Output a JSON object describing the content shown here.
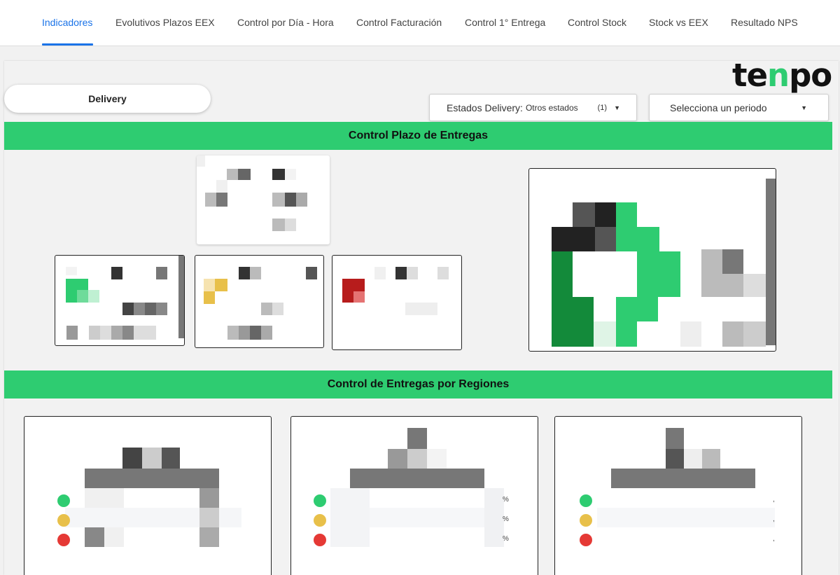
{
  "nav": {
    "tabs": [
      {
        "label": "Indicadores",
        "active": true
      },
      {
        "label": "Evolutivos Plazos EEX"
      },
      {
        "label": "Control por Día - Hora"
      },
      {
        "label": "Control Facturación"
      },
      {
        "label": "Control 1° Entrega"
      },
      {
        "label": "Control Stock"
      },
      {
        "label": "Stock vs EEX"
      },
      {
        "label": "Resultado NPS"
      }
    ]
  },
  "brand": {
    "logo_text_a": "te",
    "logo_text_m": "n",
    "logo_text_b": "po",
    "accent": "#2ecc71"
  },
  "toolbar": {
    "segment_label": "Delivery",
    "status_filter": {
      "label": "Estados Delivery:",
      "value": "Otros estados",
      "count": "(1)"
    },
    "period_filter": {
      "label": "Selecciona un periodo"
    }
  },
  "sections": {
    "plazo_title": "Control Plazo de Entregas",
    "regiones_title": "Control de Entregas por Regiones"
  },
  "regions": [
    {
      "percent_suffix": [
        "",
        "",
        ""
      ]
    },
    {
      "percent_suffix": [
        "%",
        "%",
        "%"
      ]
    },
    {
      "percent_suffix": [
        ",",
        ",",
        ","
      ]
    }
  ],
  "status_colors": {
    "green": "#2ecc71",
    "yellow": "#e8c04a",
    "red": "#e53935"
  }
}
